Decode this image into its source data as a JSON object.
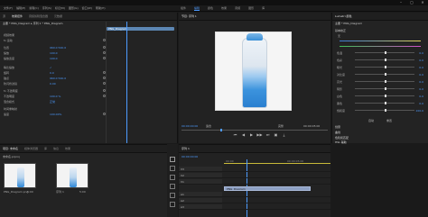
{
  "titlebar": {
    "close": "✕",
    "maximize": "▢",
    "minimize": "–"
  },
  "menubar": {
    "items": [
      "文件(F)",
      "编辑(E)",
      "剪辑(C)",
      "序列(S)",
      "标记(M)",
      "图形(G)",
      "窗口(W)",
      "帮助(H)"
    ]
  },
  "workspaces": {
    "items": [
      "组件",
      "编辑",
      "颜色",
      "效果",
      "音频",
      "图形",
      "库"
    ],
    "active_index": 1
  },
  "effect_panel": {
    "tabs": [
      "源",
      "效果控件",
      "音频剪辑混合器",
      "元数据"
    ],
    "active_tab": 1,
    "header": "主要 * PNG_Diagram  ▸  序列 1 * PNG_Diagram",
    "clip_label": "PNG_Diagram",
    "rows": [
      {
        "label": "视频效果",
        "value": ""
      },
      {
        "label": "fx 运动",
        "value": ""
      },
      {
        "label": "  位置",
        "value": "960.0   540.0"
      },
      {
        "label": "  缩放",
        "value": "100.0"
      },
      {
        "label": "  缩放宽度",
        "value": "100.0"
      },
      {
        "label": "  等比缩放",
        "value": "✓"
      },
      {
        "label": "  旋转",
        "value": "0.0"
      },
      {
        "label": "  锚点",
        "value": "960.0   540.0"
      },
      {
        "label": "  防闪烁滤镜",
        "value": "0.00"
      },
      {
        "label": "fx 不透明度",
        "value": ""
      },
      {
        "label": "  不透明度",
        "value": "100.0 %"
      },
      {
        "label": "  混合模式",
        "value": "正常"
      },
      {
        "label": "时间重映射",
        "value": ""
      },
      {
        "label": "  速度",
        "value": "100.00%"
      }
    ]
  },
  "program": {
    "title": "节目: 序列 1",
    "timecode_left": "00:00:00:00",
    "zoom": "适合",
    "quality": "完整",
    "timecode_right": "00:00:05:00",
    "transport": [
      "⏮",
      "◀",
      "▶",
      "▶▶",
      "⏭",
      "▣",
      "⤓"
    ]
  },
  "lumetri": {
    "title": "Lumetri 颜色",
    "source": "主要 * PNG_Diagram",
    "sections": [
      "基本校正",
      "创意",
      "曲线",
      "色轮和匹配",
      "HSL 辅助",
      "晕影"
    ],
    "input_lut": "无",
    "sliders": [
      {
        "label": "色温",
        "value": "0.0",
        "pos": 0.5
      },
      {
        "label": "色彩",
        "value": "0.0",
        "pos": 0.5
      },
      {
        "label": "曝光",
        "value": "0.0",
        "pos": 0.5
      },
      {
        "label": "对比度",
        "value": "0.0",
        "pos": 0.5
      },
      {
        "label": "高光",
        "value": "0.0",
        "pos": 0.5
      },
      {
        "label": "阴影",
        "value": "0.0",
        "pos": 0.5
      },
      {
        "label": "白色",
        "value": "0.0",
        "pos": 0.5
      },
      {
        "label": "黑色",
        "value": "0.0",
        "pos": 0.5
      },
      {
        "label": "饱和度",
        "value": "100.0",
        "pos": 0.5
      }
    ],
    "auto_button": "自动",
    "reset_button": "重置"
  },
  "project": {
    "tabs": [
      "项目: 未命名",
      "媒体浏览器",
      "库",
      "信息",
      "效果"
    ],
    "active_tab": 0,
    "path": "未命名.prproj",
    "items": [
      {
        "name": "PNG_Diagram.png",
        "duration": "5:00"
      },
      {
        "name": "序列 1",
        "duration": "5:00"
      }
    ]
  },
  "timeline": {
    "title": "序列 1",
    "timecode": "00:00:00:00",
    "ruler": [
      "00:00",
      "00:00:05:00"
    ],
    "tracks": [
      {
        "name": "V3"
      },
      {
        "name": "V2"
      },
      {
        "name": "V1"
      },
      {
        "name": "A1"
      },
      {
        "name": "A2"
      },
      {
        "name": "A3"
      }
    ],
    "clip_name": "PNG_Diagram"
  }
}
